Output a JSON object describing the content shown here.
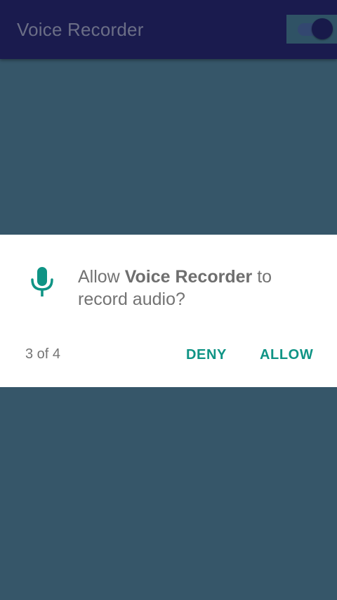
{
  "app_bar": {
    "title": "Voice Recorder",
    "toggle_state": "on",
    "icon": "toggle-switch-icon"
  },
  "dialog": {
    "icon": "microphone-icon",
    "message_prefix": "Allow ",
    "app_name": "Voice Recorder",
    "message_suffix": " to record audio?",
    "counter": "3 of 4",
    "deny_label": "DENY",
    "allow_label": "ALLOW"
  },
  "colors": {
    "app_bar_bg": "#1a1b4e",
    "scrim_bg": "#365669",
    "dialog_bg": "#ffffff",
    "accent": "#0f9485",
    "text_secondary": "#737373"
  }
}
